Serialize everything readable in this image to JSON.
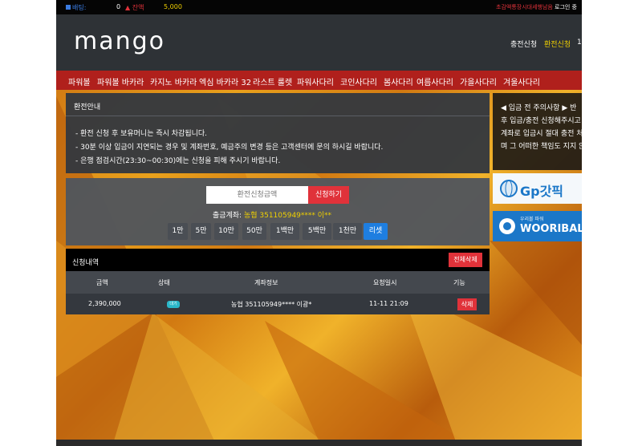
{
  "topbar": {
    "betting_label": "배팅:",
    "betting_value": "0",
    "cash_label": "잔액",
    "cash_value": "5,000",
    "notice_text": "초감액통장시대세행남음",
    "logout": "로그인 중"
  },
  "header": {
    "logo": "mango",
    "nav": [
      "충전신청",
      "환전신청",
      "1:"
    ]
  },
  "menu": [
    "파워볼",
    "파워볼 바카라",
    "카지노 바카라",
    "엑심 바카라 32",
    "라스트 룰렛",
    "파워사다리",
    "코인사다리",
    "봄사다리",
    "여름사다리",
    "가을사다리",
    "겨울사다리"
  ],
  "exchange_info": {
    "title": "환전안내",
    "lines": [
      "- 환전 신청 후 보유머니는 즉시 차감됩니다.",
      "- 30분 이상 입금이 지연되는 경우 및 계좌번호, 예금주의 변경 등은 고객센터에 문의 하시길 바랍니다.",
      "- 은행 점검시간(23:30~00:30)에는 신청을 피해 주시기 바랍니다."
    ]
  },
  "form": {
    "placeholder": "환전신청금액",
    "apply": "신청하기",
    "account_label": "출금계좌:",
    "account_value": "농협 351105949**** 이**",
    "amounts": [
      "1만",
      "5만",
      "10만",
      "50만",
      "1백만",
      "5백만",
      "1천만",
      "리셋"
    ]
  },
  "history": {
    "title": "신청내역",
    "delete_all": "전체삭제",
    "columns": [
      "금액",
      "상태",
      "계좌정보",
      "요청일시",
      "기능"
    ],
    "rows": [
      {
        "amount": "2,390,000",
        "status": "대기",
        "account": "농협 351105949**** 이광*",
        "date": "11-11 21:09",
        "action": "삭제"
      }
    ]
  },
  "sidebar": {
    "warn_lines": [
      "◀ 입금 전 주의사항 ▶ 반",
      "후 입금/충전 신청해주시고",
      "계좌로 입금시 절대 충전 처",
      "며 그 어떠한 책임도 지지 않"
    ],
    "banner1": "Gp갓픽",
    "banner2": "WOORIBALL",
    "banner2_small": "우리볼 파워"
  }
}
